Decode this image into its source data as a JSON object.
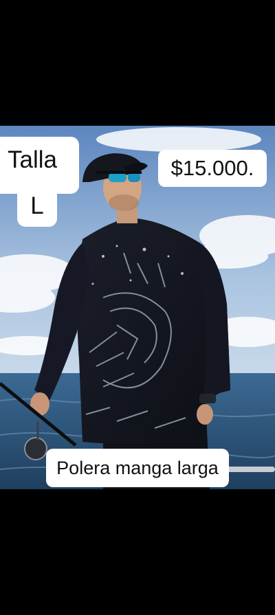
{
  "post": {
    "size_label": "Talla",
    "size_value": "L",
    "price": "$15.000.",
    "caption": "Polera manga larga"
  },
  "colors": {
    "background": "#000000",
    "sticker": "#ffffff",
    "sticker_text": "#111111",
    "sky": "#7fa6d3",
    "sea": "#2e5578",
    "shirt": "#14161f"
  },
  "icons": {
    "fishing_rod": "fishing-rod-icon"
  }
}
